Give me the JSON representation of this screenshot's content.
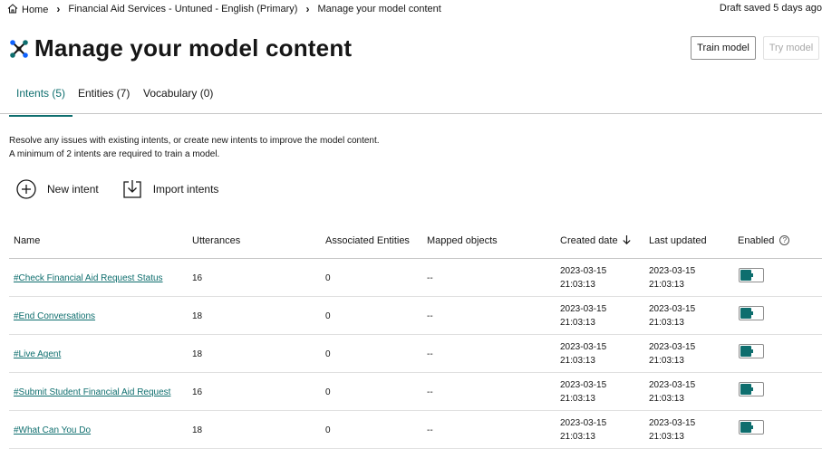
{
  "breadcrumb": {
    "home": "Home",
    "project": "Financial Aid Services - Untuned - English (Primary)",
    "current": "Manage your model content"
  },
  "draft_status": "Draft saved 5 days ago",
  "page_title": "Manage your model content",
  "buttons": {
    "train": "Train model",
    "try": "Try model"
  },
  "tabs": [
    {
      "label": "Intents (5)",
      "active": true
    },
    {
      "label": "Entities (7)",
      "active": false
    },
    {
      "label": "Vocabulary (0)",
      "active": false
    }
  ],
  "description": {
    "line1": "Resolve any issues with existing intents, or create new intents to improve the model content.",
    "line2": "A minimum of 2 intents are required to train a model."
  },
  "actions": {
    "new_intent": "New intent",
    "import_intents": "Import intents"
  },
  "table": {
    "headers": {
      "name": "Name",
      "utterances": "Utterances",
      "entities": "Associated Entities",
      "mapped": "Mapped objects",
      "created": "Created date",
      "updated": "Last updated",
      "enabled": "Enabled"
    },
    "rows": [
      {
        "name": "#Check Financial Aid Request Status",
        "utterances": "16",
        "entities": "0",
        "mapped": "--",
        "created_date": "2023-03-15",
        "created_time": "21:03:13",
        "updated_date": "2023-03-15",
        "updated_time": "21:03:13",
        "enabled": true
      },
      {
        "name": "#End Conversations",
        "utterances": "18",
        "entities": "0",
        "mapped": "--",
        "created_date": "2023-03-15",
        "created_time": "21:03:13",
        "updated_date": "2023-03-15",
        "updated_time": "21:03:13",
        "enabled": true
      },
      {
        "name": "#Live Agent",
        "utterances": "18",
        "entities": "0",
        "mapped": "--",
        "created_date": "2023-03-15",
        "created_time": "21:03:13",
        "updated_date": "2023-03-15",
        "updated_time": "21:03:13",
        "enabled": true
      },
      {
        "name": "#Submit Student Financial Aid Request",
        "utterances": "16",
        "entities": "0",
        "mapped": "--",
        "created_date": "2023-03-15",
        "created_time": "21:03:13",
        "updated_date": "2023-03-15",
        "updated_time": "21:03:13",
        "enabled": true
      },
      {
        "name": "#What Can You Do",
        "utterances": "18",
        "entities": "0",
        "mapped": "--",
        "created_date": "2023-03-15",
        "created_time": "21:03:13",
        "updated_date": "2023-03-15",
        "updated_time": "21:03:13",
        "enabled": true
      }
    ]
  },
  "colors": {
    "accent": "#0e6e6e",
    "text": "#161616",
    "border": "#c6c6c6"
  }
}
